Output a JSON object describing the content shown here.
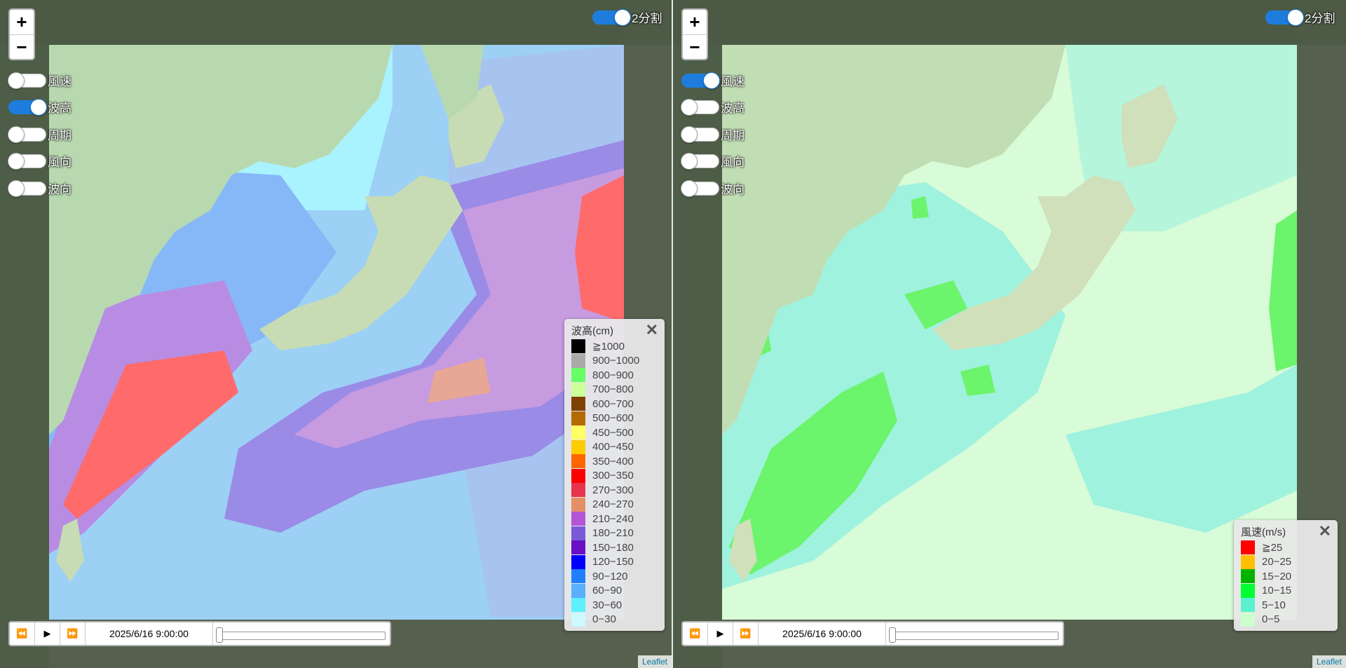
{
  "split_label": "2分割",
  "zoom": {
    "in": "+",
    "out": "−"
  },
  "toggles": [
    "風速",
    "波高",
    "周期",
    "風向",
    "波向"
  ],
  "left_panel": {
    "active_layer": "波高",
    "split_on": true,
    "legend": {
      "title": "波高(cm)",
      "close": "✕",
      "items": [
        {
          "label": "≧1000",
          "color": "#000000"
        },
        {
          "label": "900−1000",
          "color": "#a9a9a9"
        },
        {
          "label": "800−900",
          "color": "#66ff66"
        },
        {
          "label": "700−800",
          "color": "#ccff99"
        },
        {
          "label": "600−700",
          "color": "#804000"
        },
        {
          "label": "500−600",
          "color": "#b36b00"
        },
        {
          "label": "450−500",
          "color": "#ffff66"
        },
        {
          "label": "400−450",
          "color": "#ffcc00"
        },
        {
          "label": "350−400",
          "color": "#ff6600"
        },
        {
          "label": "300−350",
          "color": "#ff0000"
        },
        {
          "label": "270−300",
          "color": "#e8334d"
        },
        {
          "label": "240−270",
          "color": "#e39066"
        },
        {
          "label": "210−240",
          "color": "#b455d6"
        },
        {
          "label": "180−210",
          "color": "#7a5ad9"
        },
        {
          "label": "150−180",
          "color": "#6a0fc4"
        },
        {
          "label": "120−150",
          "color": "#0000ff"
        },
        {
          "label": "90−120",
          "color": "#1f7fff"
        },
        {
          "label": "60−90",
          "color": "#5ab0ff"
        },
        {
          "label": "30−60",
          "color": "#5ef0ff"
        },
        {
          "label": "0−30",
          "color": "#ccfaff"
        }
      ]
    },
    "timebar": {
      "time": "2025/6/16 9:00:00",
      "progress": 0
    }
  },
  "right_panel": {
    "active_layer": "風速",
    "split_on": true,
    "legend": {
      "title": "風速(m/s)",
      "close": "✕",
      "items": [
        {
          "label": "≧25",
          "color": "#ff0000"
        },
        {
          "label": "20−25",
          "color": "#ffbf00"
        },
        {
          "label": "15−20",
          "color": "#00b300"
        },
        {
          "label": "10−15",
          "color": "#00ff33"
        },
        {
          "label": "5−10",
          "color": "#5cf0d0"
        },
        {
          "label": "0−5",
          "color": "#ccffcc"
        }
      ]
    },
    "timebar": {
      "time": "2025/6/16 9:00:00",
      "progress": 0
    }
  },
  "attribution": "Leaflet"
}
